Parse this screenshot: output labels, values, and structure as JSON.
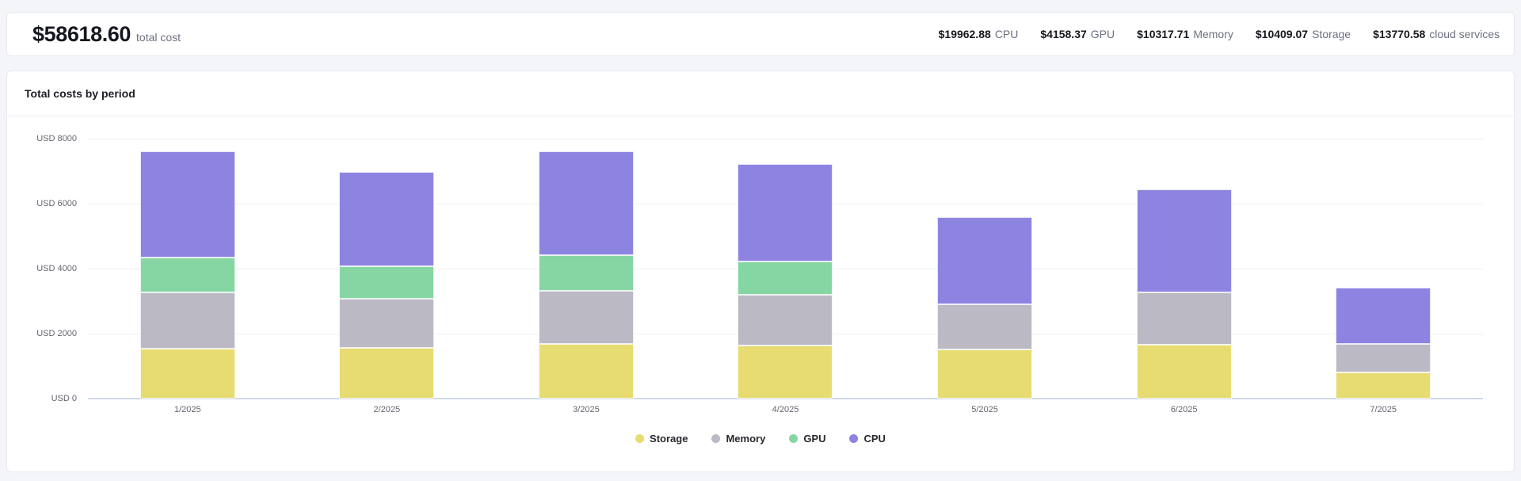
{
  "summary": {
    "total_value": "$58618.60",
    "total_label": "total cost",
    "stats": [
      {
        "value": "$19962.88",
        "label": "CPU"
      },
      {
        "value": "$4158.37",
        "label": "GPU"
      },
      {
        "value": "$10317.71",
        "label": "Memory"
      },
      {
        "value": "$10409.07",
        "label": "Storage"
      },
      {
        "value": "$13770.58",
        "label": "cloud services"
      }
    ]
  },
  "chart": {
    "title": "Total costs by period"
  },
  "chart_data": {
    "type": "bar",
    "stacked": true,
    "title": "Total costs by period",
    "categories": [
      "1/2025",
      "2/2025",
      "3/2025",
      "4/2025",
      "5/2025",
      "6/2025",
      "7/2025"
    ],
    "series": [
      {
        "name": "Storage",
        "color": "#e6dc72",
        "values": [
          1545,
          1570,
          1675,
          1635,
          1515,
          1660,
          809.07
        ]
      },
      {
        "name": "Memory",
        "color": "#bbbac4",
        "values": [
          1725,
          1505,
          1645,
          1560,
          1385,
          1618,
          879.71
        ]
      },
      {
        "name": "GPU",
        "color": "#86d6a3",
        "values": [
          1060,
          990,
          1090,
          1018.37,
          0,
          0,
          0
        ]
      },
      {
        "name": "CPU",
        "color": "#8d84e2",
        "values": [
          3270,
          2910,
          3200,
          3010,
          2690,
          3160,
          1722.88
        ]
      }
    ],
    "xlabel": "",
    "ylabel": "USD",
    "ylim": [
      0,
      8000
    ],
    "y_ticks": [
      0,
      2000,
      4000,
      6000,
      8000
    ],
    "y_tick_labels": [
      "USD 0",
      "USD 2000",
      "USD 4000",
      "USD 6000",
      "USD 8000"
    ],
    "grid": true,
    "legend_position": "bottom",
    "legend": [
      "Storage",
      "Memory",
      "GPU",
      "CPU"
    ]
  }
}
